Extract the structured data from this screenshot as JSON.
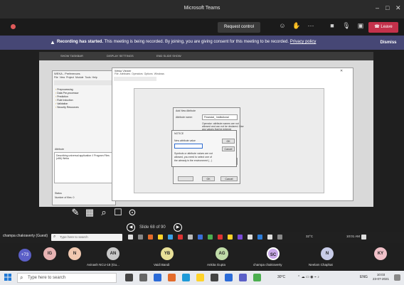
{
  "window": {
    "title": "Microsoft Teams"
  },
  "meeting": {
    "timer": "",
    "request_control_label": "Request control",
    "leave_label": "Leave"
  },
  "banner": {
    "bold": "Recording has started.",
    "text": " This meeting is being recorded. By joining, you are giving consent for this meeting to be recorded.",
    "privacy_link": "Privacy policy",
    "dismiss_label": "Dismiss"
  },
  "share_toolbar": {
    "items": [
      "SHOW TASKBAR",
      "DISPLAY SETTINGS",
      "END SLIDE SHOW"
    ]
  },
  "weka": {
    "title": "WEKA - Preferences",
    "menu": [
      "File",
      "View",
      "Project",
      "Module",
      "Tools",
      "Help"
    ],
    "tree": [
      "Preprocessing",
      "Data Pre-processor",
      "Prediction",
      "Rule Induction",
      "Validation",
      "Security Resources"
    ],
    "attribute_label": "Attribute",
    "attribute_desc": "Describing universal application // Program Files (x86) Weka",
    "status_label": "Status",
    "status_text": "Number of files: 0"
  },
  "viewer": {
    "title": "Weka Viewer",
    "menu": [
      "File",
      "Attributes",
      "Operators",
      "Options",
      "Windows"
    ]
  },
  "attr_dialog": {
    "title": "Add New Attribute",
    "name_label": "Attribute name:",
    "name_value": "Financial_ Institutional",
    "help1": "Operator: attribute names are not",
    "help2": "allowed and can not be declared. Use",
    "help3": "any values that be entered",
    "ok": "OK",
    "cancel": "Cancel"
  },
  "nominal_dialog": {
    "title": "NOTICE",
    "label": "New attribute value",
    "help1": "Symbols or attribute values are not",
    "help2": "allowed, you need to select one of",
    "help3": "the already in the environment ( , )",
    "ok": "OK",
    "cancel": "Cancel"
  },
  "pager": {
    "text": "Slide 68 of 90"
  },
  "presenter": {
    "name": "champa chakraverty (Guest)",
    "search_placeholder": "Type here to search",
    "tray_text": "32°C",
    "time": "10:01 AM"
  },
  "participants": {
    "more": "+73",
    "people": [
      {
        "initials": "IG",
        "name": "",
        "color": "#e8b3b3"
      },
      {
        "initials": "N",
        "name": "",
        "color": "#f0c8b0"
      },
      {
        "initials": "AN",
        "name": "Avinash NCU-18 (Gu...",
        "color": "#c8c8c8"
      },
      {
        "initials": "YB",
        "name": "Vaidi Bandi",
        "color": "#e8e098"
      },
      {
        "initials": "AG",
        "name": "Ankita Gupta",
        "color": "#c0dca8"
      },
      {
        "initials": "SC",
        "name": "champa chakraverty",
        "color": "#c9a8e8"
      },
      {
        "initials": "N",
        "name": "Neelam Chaphat",
        "color": "#c8cce8"
      },
      {
        "initials": "KY",
        "name": "",
        "color": "#f0c0c8"
      }
    ]
  },
  "taskbar": {
    "search_placeholder": "Type here to search",
    "temperature": "30°C",
    "language": "ENG",
    "time": "10:03",
    "date": "23-07-2021"
  },
  "colors": {
    "banner": "#464775",
    "leave": "#c4314b",
    "accent": "#5b5fc7"
  }
}
